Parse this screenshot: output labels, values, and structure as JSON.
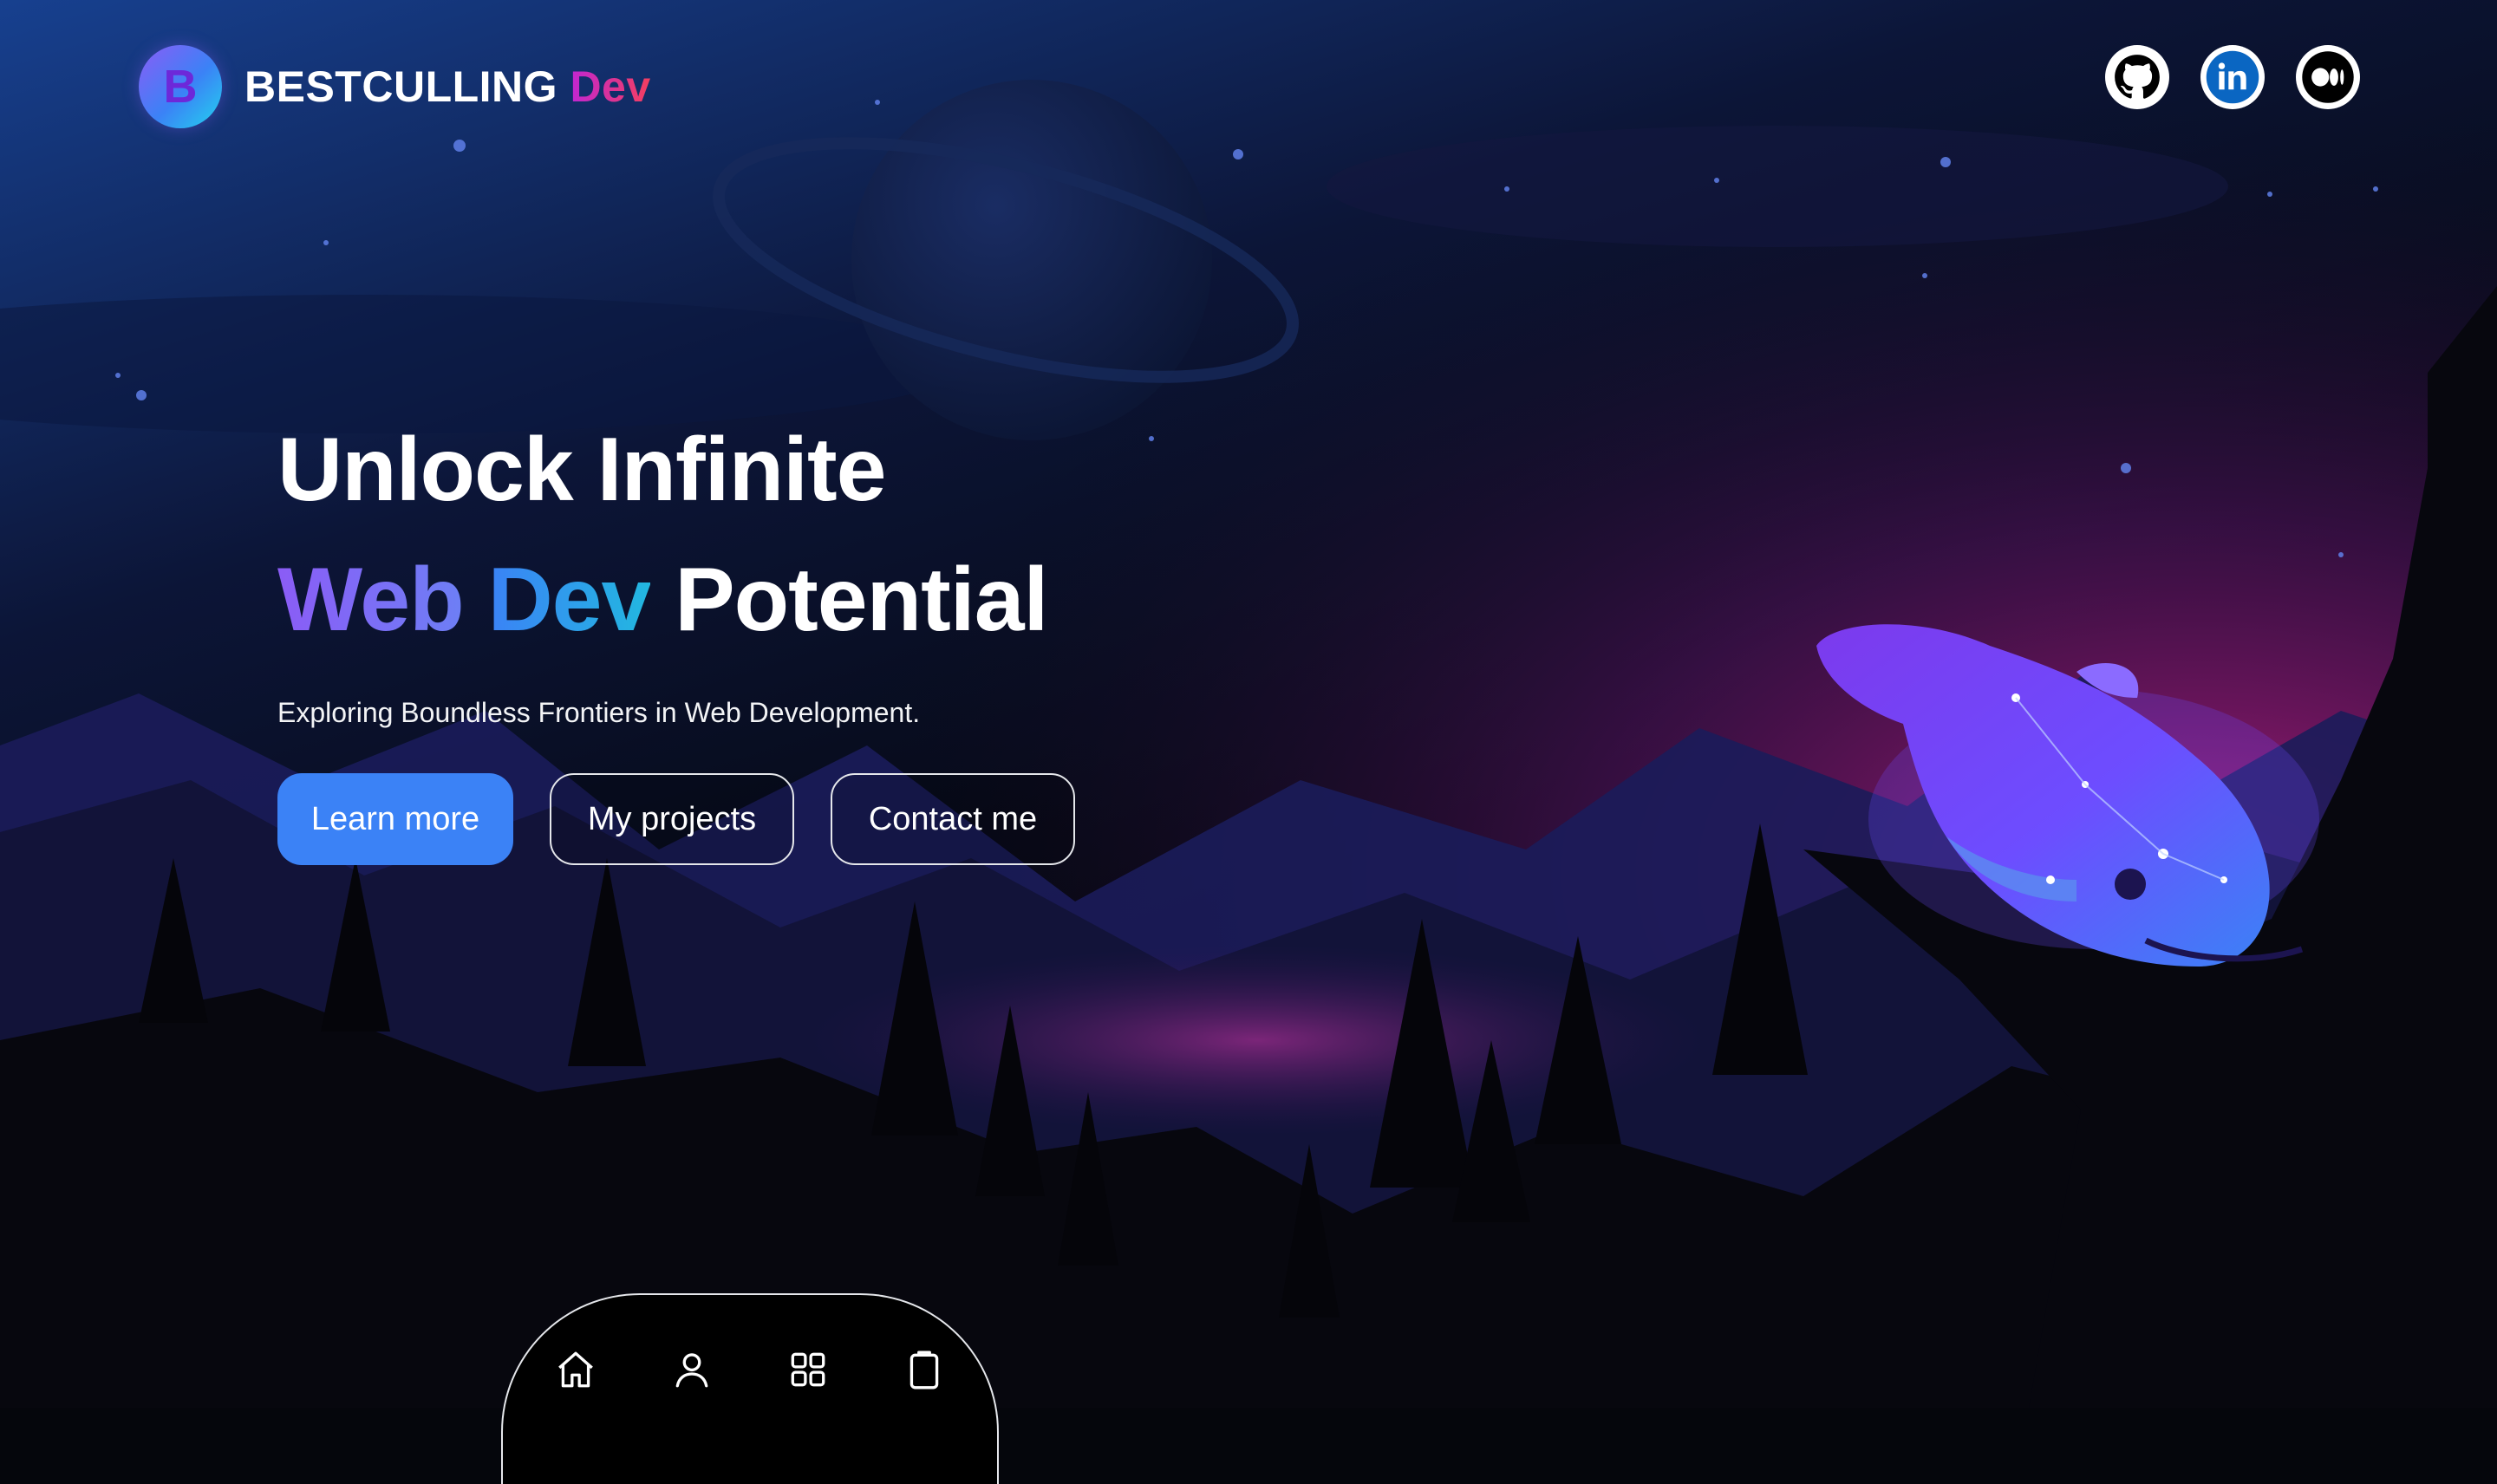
{
  "brand": {
    "name": "BESTCULLING",
    "accent": "Dev",
    "logo_letter": "B",
    "logo_icon": "brand-logo-icon"
  },
  "socials": [
    {
      "icon": "github-icon"
    },
    {
      "icon": "linkedin-icon"
    },
    {
      "icon": "medium-icon"
    }
  ],
  "hero": {
    "line1": "Unlock Infinite",
    "line2_web": "Web",
    "line2_dev": "Dev",
    "line2_rest": "Potential",
    "subtitle": "Exploring Boundless Frontiers in Web Development."
  },
  "buttons": {
    "learn_more": "Learn more",
    "projects": "My projects",
    "contact": "Contact me"
  },
  "bottom_nav": [
    {
      "icon": "home-icon"
    },
    {
      "icon": "user-icon"
    },
    {
      "icon": "grid-icon"
    },
    {
      "icon": "clipboard-icon"
    }
  ],
  "colors": {
    "primary": "#3b82f6",
    "accent_gradient_start": "#8b5cf6",
    "accent_gradient_end": "#22b8e0",
    "background_top": "#0f2a66",
    "background_magenta": "#a3177a"
  }
}
